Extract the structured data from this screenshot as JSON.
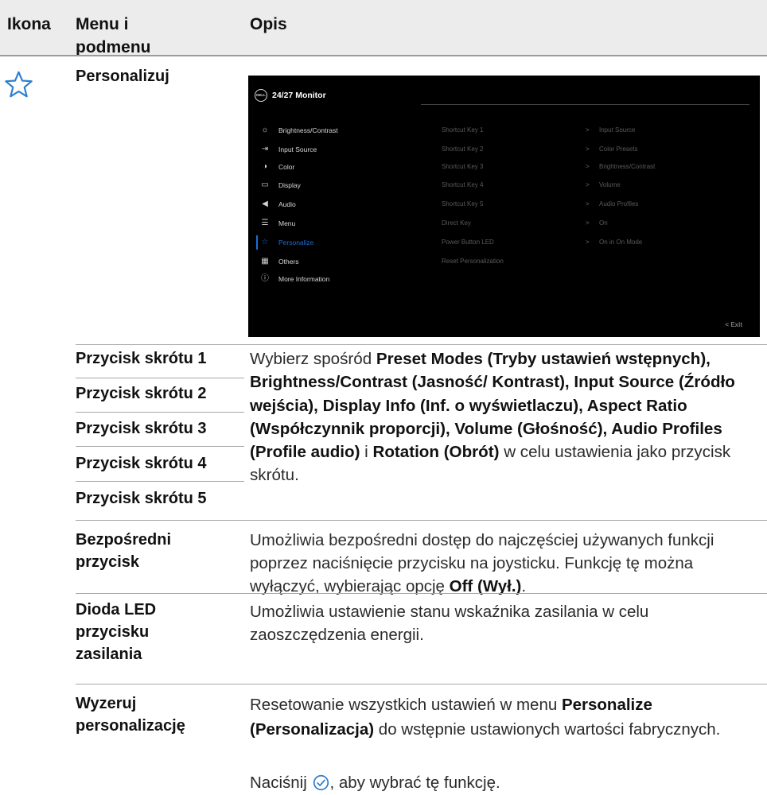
{
  "header": {
    "col_icon": "Ikona",
    "col_menu_line1": "Menu i",
    "col_menu_line2": "podmenu",
    "col_desc": "Opis"
  },
  "section": {
    "icon": "star-icon",
    "title": "Personalizuj"
  },
  "osd": {
    "logo": "DELL",
    "title": "24/27 Monitor",
    "menu": [
      {
        "icon": "sun-icon",
        "label": "Brightness/Contrast"
      },
      {
        "icon": "input-icon",
        "label": "Input Source"
      },
      {
        "icon": "palette-icon",
        "label": "Color"
      },
      {
        "icon": "display-icon",
        "label": "Display"
      },
      {
        "icon": "speaker-icon",
        "label": "Audio"
      },
      {
        "icon": "menu-icon",
        "label": "Menu"
      },
      {
        "icon": "star-icon",
        "label": "Personalize",
        "active": true
      },
      {
        "icon": "others-icon",
        "label": "Others"
      },
      {
        "icon": "info-icon",
        "label": "More Information"
      }
    ],
    "submenu": [
      {
        "label": "Shortcut Key 1",
        "arrow": ">",
        "value": "Input Source"
      },
      {
        "label": "Shortcut Key 2",
        "arrow": ">",
        "value": "Color Presets"
      },
      {
        "label": "Shortcut Key 3",
        "arrow": ">",
        "value": "Brightness/Contrast"
      },
      {
        "label": "Shortcut Key 4",
        "arrow": ">",
        "value": "Volume"
      },
      {
        "label": "Shortcut Key 5",
        "arrow": ">",
        "value": "Audio Profiles"
      },
      {
        "label": "Direct Key",
        "arrow": ">",
        "value": "On"
      },
      {
        "label": "Power Button LED",
        "arrow": ">",
        "value": "On in On Mode"
      },
      {
        "label": "Reset Personalization",
        "arrow": "",
        "value": ""
      }
    ],
    "exit": "<  Exit"
  },
  "rows": {
    "shortcut_labels": [
      "Przycisk skrótu 1",
      "Przycisk skrótu 2",
      "Przycisk skrótu 3",
      "Przycisk skrótu 4",
      "Przycisk skrótu 5"
    ],
    "shortcut_desc": {
      "t1": "Wybierz spośród ",
      "b1": "Preset Modes (Tryby ustawień wstępnych), Brightness/Contrast (Jasność/ Kontrast), Input Source (Źródło wejścia), Display Info (Inf. o wyświetlaczu), Aspect Ratio (Współczynnik proporcji), Volume (Głośność), Audio Profiles (Profile audio)",
      "t2": " i ",
      "b2": "Rotation (Obrót)",
      "t3": " w celu ustawienia jako przycisk skrótu."
    },
    "direct_key": {
      "label_line1": "Bezpośredni",
      "label_line2": "przycisk",
      "t1": "Umożliwia bezpośredni dostęp do najczęściej używanych funkcji poprzez naciśnięcie przycisku na joysticku. Funkcję tę można wyłączyć, wybierając opcję ",
      "b1": "Off (Wył.)",
      "t2": "."
    },
    "power_led": {
      "label_line1": "Dioda LED",
      "label_line2": "przycisku",
      "label_line3": "zasilania",
      "desc": "Umożliwia ustawienie stanu wskaźnika zasilania w celu zaoszczędzenia energii."
    },
    "reset": {
      "label_line1": "Wyzeruj",
      "label_line2": "personalizację",
      "t1": "Resetowanie wszystkich ustawień w menu ",
      "b1": "Personalize (Personalizacja)",
      "t2": " do wstępnie ustawionych wartości fabrycznych.",
      "press_before": "Naciśnij ",
      "press_icon": "check-circle-icon",
      "press_after": ", aby wybrać tę funkcję."
    }
  }
}
